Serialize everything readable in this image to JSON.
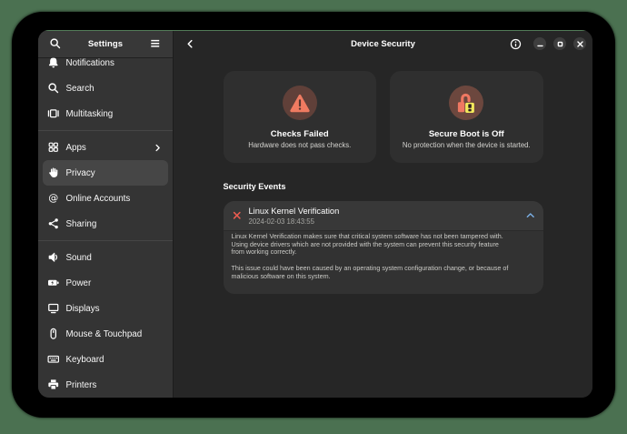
{
  "colors": {
    "backdrop_green": "#4b7151",
    "accent_blue": "#7cb1e8",
    "error_red": "#ed5c50",
    "warning_salmon": "#f2735c",
    "warning_yellow": "#f6e35a"
  },
  "sidebar": {
    "title": "Settings",
    "items": [
      {
        "label": "Notifications"
      },
      {
        "label": "Search"
      },
      {
        "label": "Multitasking"
      },
      {
        "label": "Apps"
      },
      {
        "label": "Privacy"
      },
      {
        "label": "Online Accounts"
      },
      {
        "label": "Sharing"
      },
      {
        "label": "Sound"
      },
      {
        "label": "Power"
      },
      {
        "label": "Displays"
      },
      {
        "label": "Mouse & Touchpad"
      },
      {
        "label": "Keyboard"
      },
      {
        "label": "Printers"
      }
    ]
  },
  "main": {
    "title": "Device Security",
    "cards": [
      {
        "title": "Checks Failed",
        "subtitle": "Hardware does not pass checks."
      },
      {
        "title": "Secure Boot is Off",
        "subtitle": "No protection when the device is started."
      }
    ],
    "events": {
      "section_title": "Security Events",
      "row": {
        "title": "Linux Kernel Verification",
        "timestamp": "2024-02-03 18:43:55"
      },
      "description": {
        "paragraph1": [
          "Linux Kernel Verification makes sure that critical system software has not been tampered with.",
          "Using device drivers which are not provided with the system can prevent this security feature",
          "from working correctly."
        ],
        "paragraph2": [
          "This issue could have been caused by an operating system configuration change, or because of",
          "malicious software on this system."
        ]
      }
    }
  }
}
